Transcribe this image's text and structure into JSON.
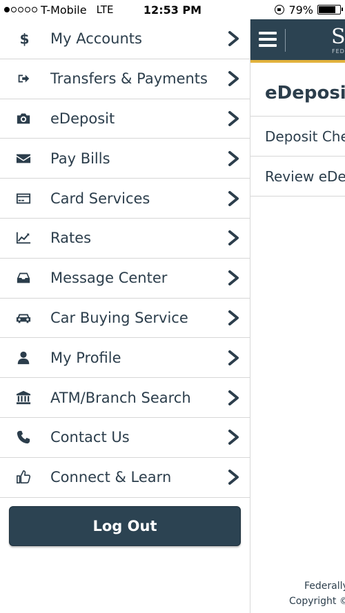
{
  "status_bar": {
    "carrier": "T-Mobile",
    "network": "LTE",
    "time": "12:53 PM",
    "battery": "79%",
    "battery_level": 0.79,
    "signal_bars": 1
  },
  "menu": {
    "items": [
      {
        "label": "My Accounts",
        "icon": "dollar-icon"
      },
      {
        "label": "Transfers & Payments",
        "icon": "sign-out-icon"
      },
      {
        "label": "eDeposit",
        "icon": "camera-icon"
      },
      {
        "label": "Pay Bills",
        "icon": "envelope-icon"
      },
      {
        "label": "Card Services",
        "icon": "credit-card-icon"
      },
      {
        "label": "Rates",
        "icon": "line-chart-icon"
      },
      {
        "label": "Message Center",
        "icon": "inbox-icon"
      },
      {
        "label": "Car Buying Service",
        "icon": "car-icon"
      },
      {
        "label": "My Profile",
        "icon": "user-icon"
      },
      {
        "label": "ATM/Branch Search",
        "icon": "bank-icon"
      },
      {
        "label": "Contact Us",
        "icon": "phone-icon"
      },
      {
        "label": "Connect & Learn",
        "icon": "thumbs-up-icon"
      }
    ],
    "logout_label": "Log Out"
  },
  "main": {
    "brand_letter": "S",
    "brand_sub": "FED",
    "title": "eDeposit",
    "sub_items": [
      "Deposit Che",
      "Review eDep"
    ],
    "footer_line1": "Federally",
    "footer_line2": "Copyright ©"
  },
  "colors": {
    "primary": "#2c4352",
    "accent": "#e2b23c",
    "text": "#2c3e4c"
  }
}
